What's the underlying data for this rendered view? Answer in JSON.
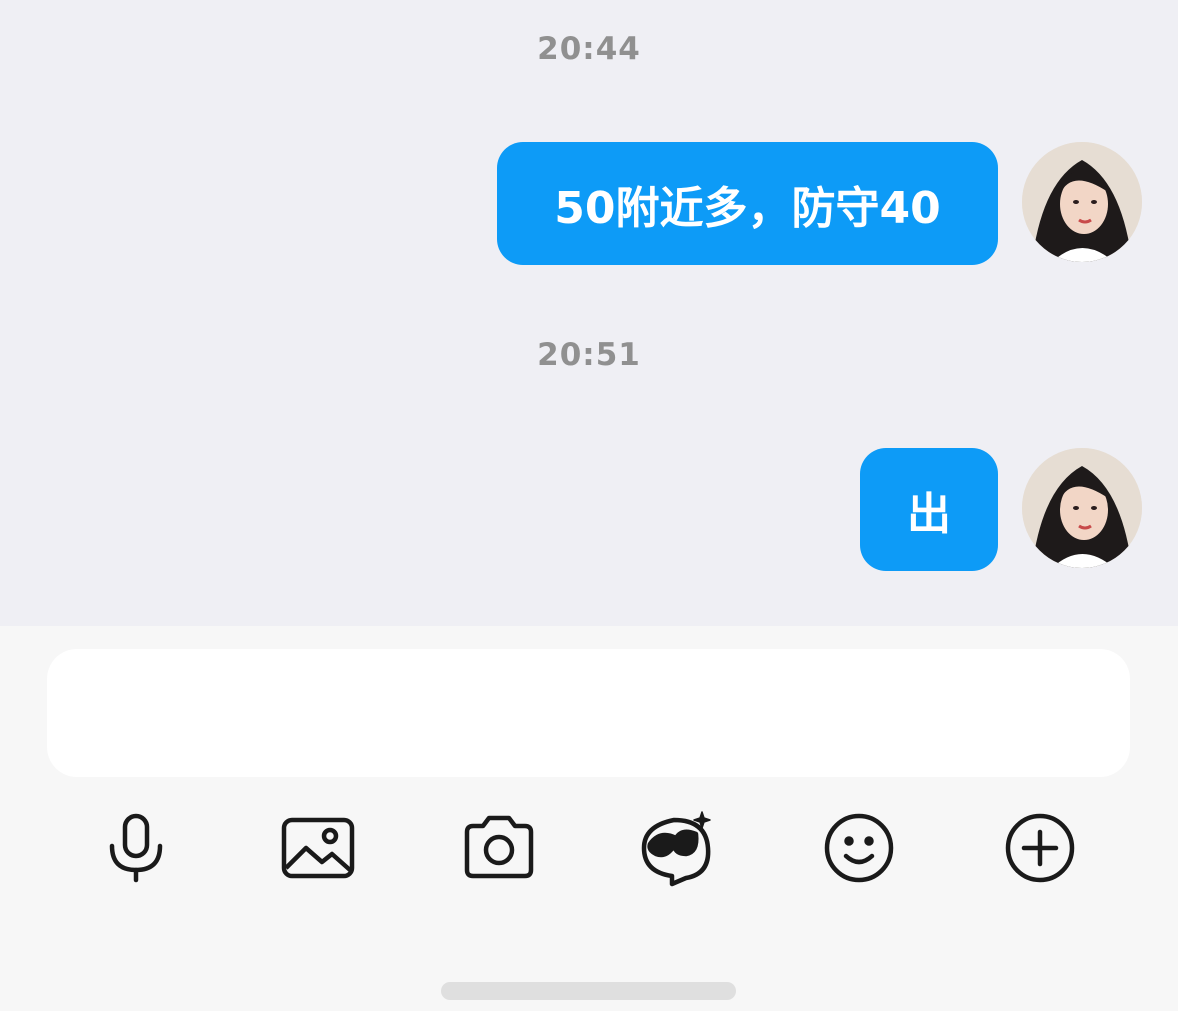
{
  "messages": [
    {
      "time": "20:44",
      "text": "50附近多，防守40",
      "sender": "self"
    },
    {
      "time": "20:51",
      "text": "出",
      "sender": "self"
    }
  ],
  "input": {
    "value": "",
    "placeholder": ""
  },
  "toolbar": {
    "icons": [
      "microphone-icon",
      "image-icon",
      "camera-icon",
      "ai-assistant-icon",
      "emoji-icon",
      "plus-icon"
    ]
  },
  "colors": {
    "bubble": "#0d9bf7",
    "chat_background": "#efeff4",
    "bottom_bar": "#f7f7f7",
    "timestamp": "#909090"
  }
}
